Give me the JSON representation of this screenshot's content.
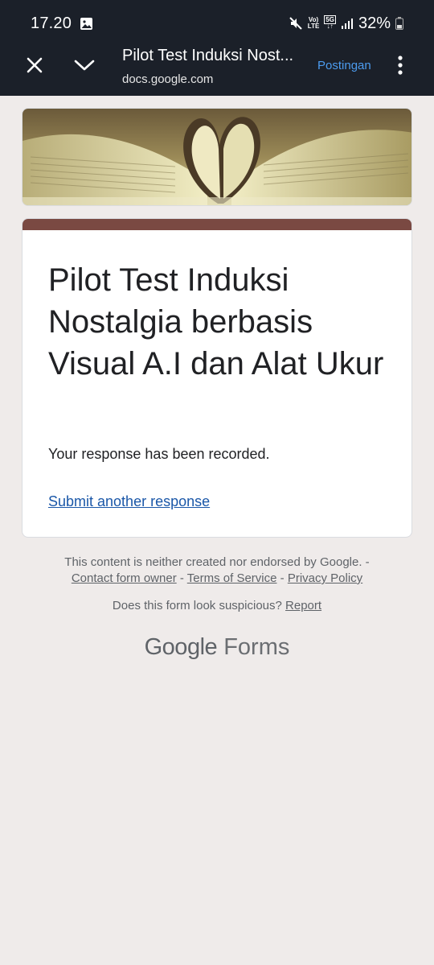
{
  "status_bar": {
    "time": "17.20",
    "volte_label_top": "Vo)",
    "volte_label_bottom": "LTE",
    "network_label": "5G",
    "battery_percent": "32%"
  },
  "browser": {
    "title": "Pilot Test Induksi Nost...",
    "url": "docs.google.com",
    "action_label": "Postingan"
  },
  "form": {
    "title": "Pilot Test Induksi Nostalgia berbasis Visual A.I dan Alat Ukur",
    "message": "Your response has been recorded.",
    "submit_another_label": "Submit another response",
    "accent_color": "#7a4942"
  },
  "footer": {
    "disclaimer": "This content is neither created nor endorsed by Google. -",
    "contact_link": "Contact form owner",
    "sep1": "-",
    "terms_link": "Terms of Service",
    "sep2": "-",
    "privacy_link": "Privacy Policy",
    "suspicious_text": "Does this form look suspicious?",
    "report_link": "Report",
    "brand_google": "Google",
    "brand_forms": "Forms"
  }
}
